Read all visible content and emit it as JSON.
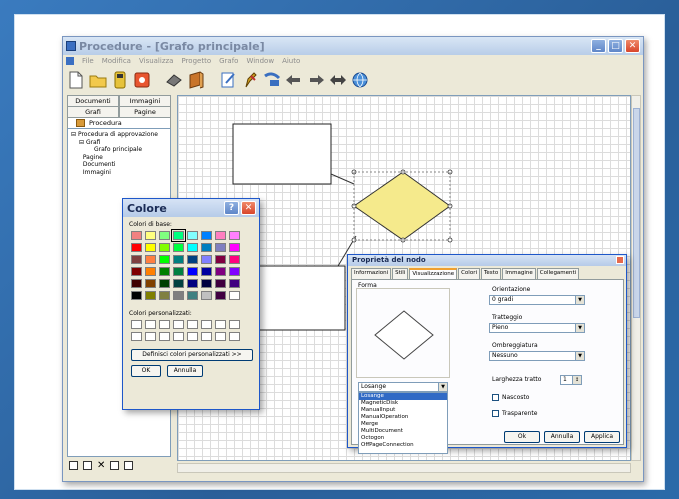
{
  "window": {
    "title": "Procedure - [Grafo principale]",
    "menu": [
      "File",
      "Modifica",
      "Visualizza",
      "Progetto",
      "Grafo",
      "Window",
      "Aiuto"
    ]
  },
  "toolbar": {
    "icons": [
      "new-file-icon",
      "open-folder-icon",
      "save-icon",
      "record-icon",
      "eraser-icon",
      "book-icon",
      "edit-page-icon",
      "pen-icon",
      "link-icon",
      "arrow-left-icon",
      "arrow-right-icon",
      "arrow-double-icon",
      "globe-icon"
    ]
  },
  "leftpanel": {
    "tabs_row1": [
      "Documenti",
      "Immagini"
    ],
    "tabs_row2": [
      "Grafi",
      "Pagine"
    ],
    "tab_active": "Procedura",
    "tree": [
      {
        "label": "Procedura di approvazione",
        "level": 1,
        "prefix": "⊟"
      },
      {
        "label": "Grafi",
        "level": 2,
        "prefix": "⊟"
      },
      {
        "label": "Grafo principale",
        "level": 3,
        "prefix": ""
      },
      {
        "label": "Pagine",
        "level": 2,
        "prefix": ""
      },
      {
        "label": "Documenti",
        "level": 2,
        "prefix": ""
      },
      {
        "label": "Immagini",
        "level": 2,
        "prefix": ""
      }
    ]
  },
  "color_dialog": {
    "title": "Colore",
    "basic_label": "Colori di base:",
    "custom_label": "Colori personalizzati:",
    "define_button": "Definisci colori personalizzati >>",
    "ok_button": "OK",
    "cancel_button": "Annulla",
    "basic_colors": [
      "#f08080",
      "#ffff80",
      "#80ff80",
      "#00ff80",
      "#80ffff",
      "#0080ff",
      "#ff80c0",
      "#ff80ff",
      "#ff0000",
      "#ffff00",
      "#80ff00",
      "#00ff40",
      "#00ffff",
      "#0080c0",
      "#8080c0",
      "#ff00ff",
      "#804040",
      "#ff8040",
      "#00ff00",
      "#008080",
      "#004080",
      "#8080ff",
      "#800040",
      "#ff0080",
      "#800000",
      "#ff8000",
      "#008000",
      "#008040",
      "#0000ff",
      "#0000a0",
      "#800080",
      "#8000ff",
      "#400000",
      "#804000",
      "#004000",
      "#004040",
      "#000080",
      "#000040",
      "#400040",
      "#400080",
      "#000000",
      "#808000",
      "#808040",
      "#808080",
      "#408080",
      "#c0c0c0",
      "#400040",
      "#ffffff"
    ],
    "selected_index": 3
  },
  "properties_dialog": {
    "title": "Proprietà del nodo",
    "tabs": [
      "Informazioni",
      "Stili",
      "Visualizzazione",
      "Colori",
      "Testo",
      "Immagine",
      "Collegamenti"
    ],
    "active_tab": "Visualizzazione",
    "shape_group": "Forma",
    "shape_value": "Losange",
    "shape_options": [
      "Losange",
      "MagneticDisk",
      "ManualInput",
      "ManualOperation",
      "Merge",
      "MultiDocument",
      "Octogon",
      "OffPageConnection"
    ],
    "orientation_label": "Orientazione",
    "orientation_value": "0 gradi",
    "dash_label": "Tratteggio",
    "dash_value": "Pieno",
    "shadow_label": "Ombreggiatura",
    "shadow_value": "Nessuno",
    "line_width_label": "Larghezza tratto",
    "line_width_value": "1",
    "hidden_label": "Nascosto",
    "transparent_label": "Trasparente",
    "ok_button": "Ok",
    "cancel_button": "Annulla",
    "apply_button": "Applica"
  },
  "colors": {
    "diamond_fill": "#f5ea8c",
    "accent": "#2a5f99"
  }
}
